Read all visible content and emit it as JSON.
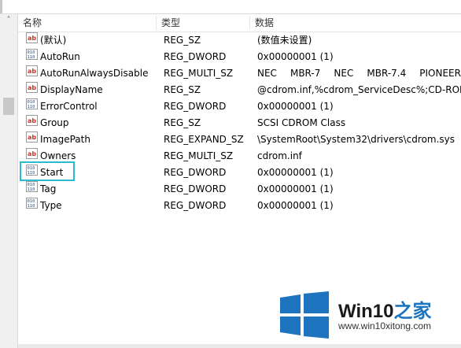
{
  "header": {
    "col_name": "名称",
    "col_type": "类型",
    "col_data": "数据"
  },
  "rows": [
    {
      "icon": "string-value-icon",
      "name": "(默认)",
      "type": "REG_SZ",
      "data": "(数值未设置)"
    },
    {
      "icon": "binary-value-icon",
      "name": "AutoRun",
      "type": "REG_DWORD",
      "data": "0x00000001 (1)"
    },
    {
      "icon": "string-value-icon",
      "name": "AutoRunAlwaysDisable",
      "type": "REG_MULTI_SZ",
      "data": "NEC MBR-7 NEC MBR-7.4 PIONEER"
    },
    {
      "icon": "string-value-icon",
      "name": "DisplayName",
      "type": "REG_SZ",
      "data": "@cdrom.inf,%cdrom_ServiceDesc%;CD-ROM"
    },
    {
      "icon": "binary-value-icon",
      "name": "ErrorControl",
      "type": "REG_DWORD",
      "data": "0x00000001 (1)"
    },
    {
      "icon": "string-value-icon",
      "name": "Group",
      "type": "REG_SZ",
      "data": "SCSI CDROM Class"
    },
    {
      "icon": "string-value-icon",
      "name": "ImagePath",
      "type": "REG_EXPAND_SZ",
      "data": "\\SystemRoot\\System32\\drivers\\cdrom.sys"
    },
    {
      "icon": "string-value-icon",
      "name": "Owners",
      "type": "REG_MULTI_SZ",
      "data": "cdrom.inf"
    },
    {
      "icon": "binary-value-icon",
      "name": "Start",
      "type": "REG_DWORD",
      "data": "0x00000001 (1)"
    },
    {
      "icon": "binary-value-icon",
      "name": "Tag",
      "type": "REG_DWORD",
      "data": "0x00000001 (1)"
    },
    {
      "icon": "binary-value-icon",
      "name": "Type",
      "type": "REG_DWORD",
      "data": "0x00000001 (1)"
    }
  ],
  "autorun_disable_tokens": [
    "NEC",
    "MBR-7",
    "NEC",
    "MBR-7.4",
    "PIONEER"
  ],
  "watermark": {
    "brand_prefix": "Win10",
    "brand_suffix": "之家",
    "site": "www.win10xitong.com"
  },
  "colors": {
    "highlight": "#2bbbd0",
    "logo_blue": "#1e73be"
  }
}
